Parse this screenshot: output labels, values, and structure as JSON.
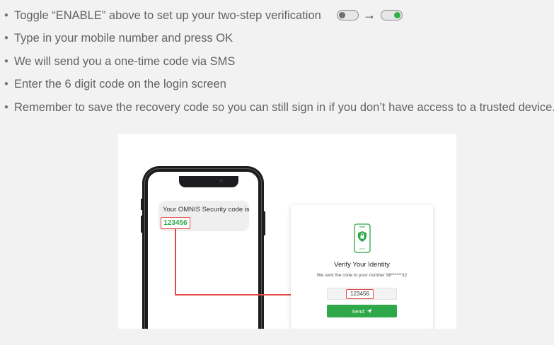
{
  "steps": [
    "Toggle “ENABLE” above to set up your two-step verification",
    "Type in your mobile number and press OK",
    "We will send you a one-time code via SMS",
    "Enter the 6 digit code on the login screen",
    "Remember to save the recovery code so you can still sign in if you don’t have access to a trusted device."
  ],
  "bullet": "•",
  "toggle": {
    "arrow": "→",
    "off_color": "#6e6e6e",
    "on_color": "#2fb14a"
  },
  "phone": {
    "sms_text": "Your OMNIS Security code is",
    "sms_code": "123456"
  },
  "verify": {
    "icon": "smartphone-lock-icon",
    "title": "Verify Your Identity",
    "subtitle": "We sent the code to your number 98******32",
    "code_value": "123456",
    "send_label": "Send",
    "send_icon": "paper-plane-icon"
  },
  "colors": {
    "accent": "#2fa84a",
    "highlight": "#e34b4b"
  }
}
